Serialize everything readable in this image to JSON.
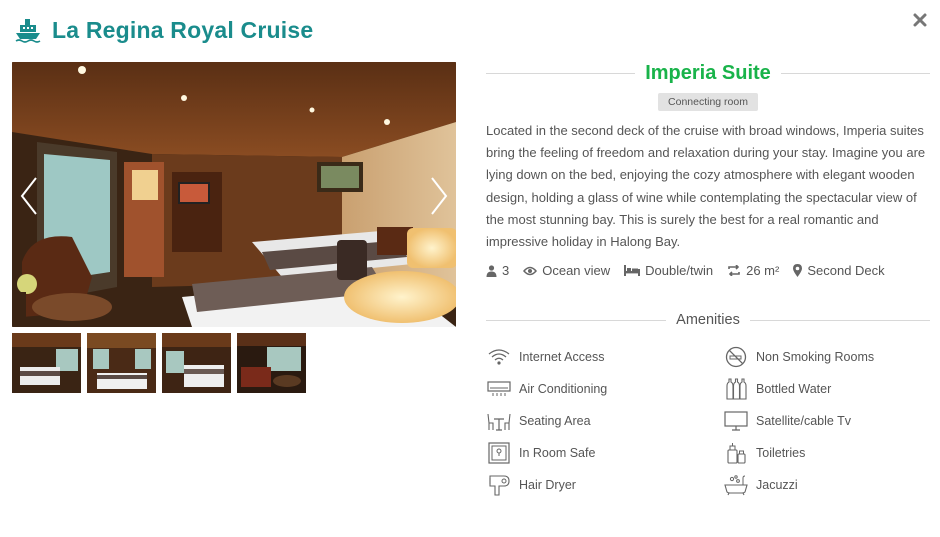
{
  "header": {
    "title": "La Regina Royal Cruise",
    "icon": "ship-icon"
  },
  "close_icon": "close-icon",
  "colors": {
    "brand": "#1a8c8c",
    "room_title": "#19b34a",
    "badge_bg": "#e2e2e2"
  },
  "room": {
    "name": "Imperia Suite",
    "badge": "Connecting room",
    "description": "Located in the second deck of the cruise with broad windows, Imperia suites bring the feeling of freedom and relaxation during your stay. Imagine you are lying down on the bed, enjoying the cozy atmosphere with elegant wooden design, holding a glass of wine while contemplating the spectacular view of the most stunning bay. This is surely the best for a real romantic and impressive holiday in Halong Bay.",
    "specs": {
      "guests": "3",
      "view": "Ocean view",
      "bed": "Double/twin",
      "size": "26 m²",
      "deck": "Second Deck"
    }
  },
  "amenities_title": "Amenities",
  "amenities": [
    {
      "label": "Internet Access",
      "icon": "wifi-icon"
    },
    {
      "label": "Non Smoking Rooms",
      "icon": "no-smoking-icon"
    },
    {
      "label": "Air Conditioning",
      "icon": "air-conditioner-icon"
    },
    {
      "label": "Bottled Water",
      "icon": "bottles-icon"
    },
    {
      "label": "Seating Area",
      "icon": "seating-icon"
    },
    {
      "label": "Satellite/cable Tv",
      "icon": "tv-icon"
    },
    {
      "label": "In Room Safe",
      "icon": "safe-icon"
    },
    {
      "label": "Toiletries",
      "icon": "toiletries-icon"
    },
    {
      "label": "Hair Dryer",
      "icon": "hair-dryer-icon"
    },
    {
      "label": "Jacuzzi",
      "icon": "jacuzzi-icon"
    }
  ]
}
